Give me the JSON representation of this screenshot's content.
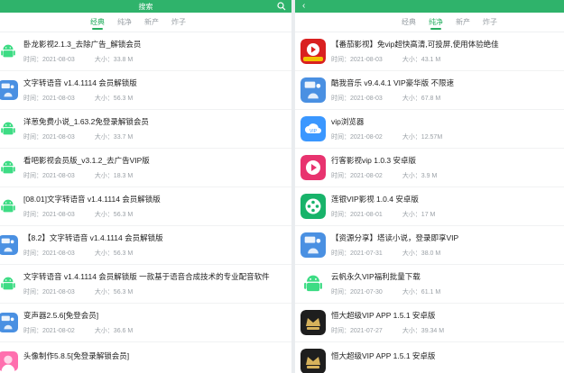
{
  "left": {
    "title": "搜索",
    "tabs": [
      "经典",
      "纯净",
      "新产",
      "炸子"
    ],
    "items": [
      {
        "title": "卧龙影视2.1.3_去除广告_解锁会员",
        "time": "时间：2021-08-03",
        "size": "大小：33.8 M",
        "icon": "android-icon"
      },
      {
        "title": "文字转语音 v1.4.1114 会员解锁版",
        "time": "时间：2021-08-03",
        "size": "大小：56.3 M",
        "icon": "app-blue-icon"
      },
      {
        "title": "洋葱免费小说_1.63.2免登录解锁会员",
        "time": "时间：2021-08-03",
        "size": "大小：33.7 M",
        "icon": "android-icon"
      },
      {
        "title": "看吧影视会员版_v3.1.2_去广告VIP版",
        "time": "时间：2021-08-03",
        "size": "大小：18.3 M",
        "icon": "android-icon"
      },
      {
        "title": "[08.01]文字转语音 v1.4.1114 会员解锁版",
        "time": "时间：2021-08-03",
        "size": "大小：56.3 M",
        "icon": "android-icon"
      },
      {
        "title": "【8.2】文字转语音 v1.4.1114 会员解锁版",
        "time": "时间：2021-08-03",
        "size": "大小：56.3 M",
        "icon": "app-blue-icon"
      },
      {
        "title": "文字转语音 v1.4.1114 会员解锁版 一款基于语音合成技术的专业配音软件",
        "time": "时间：2021-08-03",
        "size": "大小：56.3 M",
        "icon": "android-icon"
      },
      {
        "title": "变声器2.5.6[免登会员]",
        "time": "时间：2021-08-02",
        "size": "大小：36.6 M",
        "icon": "app-blue-icon"
      },
      {
        "title": "头像制作5.8.5[免登录解锁会员]",
        "time": "",
        "size": "",
        "icon": "avatar-app-icon"
      }
    ]
  },
  "right": {
    "tabs": [
      "经典",
      "纯净",
      "新产",
      "炸子"
    ],
    "items": [
      {
        "title": "【番茄影视】免vip超快高清,可投屏,使用体验绝佳",
        "time": "时间：2021-08-03",
        "size": "大小：43.1 M",
        "icon": "play-red-icon"
      },
      {
        "title": "酷我音乐 v9.4.4.1 VIP豪华版 不限速",
        "time": "时间：2021-08-03",
        "size": "大小：67.8 M",
        "icon": "app-blue-icon"
      },
      {
        "title": "vip浏览器",
        "time": "时间：2021-08-02",
        "size": "大小：12.57M",
        "icon": "cloud-icon"
      },
      {
        "title": "行客影视vip 1.0.3 安卓版",
        "time": "时间：2021-08-02",
        "size": "大小：3.9 M",
        "icon": "play-pink-icon"
      },
      {
        "title": "莲银VIP影视 1.0.4 安卓版",
        "time": "时间：2021-08-01",
        "size": "大小：17 M",
        "icon": "film-icon"
      },
      {
        "title": "【资源分享】塔读小说，登录即享VIP",
        "time": "时间：2021-07-31",
        "size": "大小：38.0 M",
        "icon": "app-blue-icon"
      },
      {
        "title": "云帆永久VIP福利批量下载",
        "time": "时间：2021-07-30",
        "size": "大小：61.1 M",
        "icon": "android-icon"
      },
      {
        "title": "恒大超级VIP APP 1.5.1 安卓版",
        "time": "时间：2021-07-27",
        "size": "大小：39.34 M",
        "icon": "crown-icon"
      },
      {
        "title": "恒大超级VIP APP 1.5.1 安卓版",
        "time": "",
        "size": "",
        "icon": "crown-icon"
      }
    ]
  },
  "colors": {
    "accent": "#27ae60",
    "topbar": "#2fb36b"
  }
}
